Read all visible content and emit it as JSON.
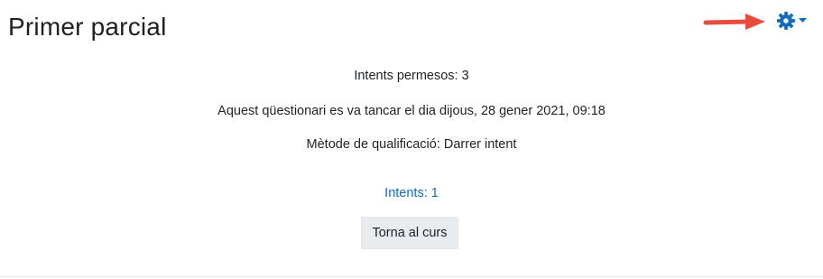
{
  "header": {
    "title": "Primer parcial"
  },
  "quiz_info": {
    "attempts_allowed": "Intents permesos: 3",
    "closed_notice": "Aquest qüestionari es va tancar el dia dijous, 28 gener 2021, 09:18",
    "grading_method": "Mètode de qualificació: Darrer intent"
  },
  "attempts_link": "Intents: 1",
  "back_button_label": "Torna al curs",
  "icons": {
    "settings": "gear-icon",
    "dropdown": "caret-down-icon",
    "annotation": "red-arrow-icon"
  },
  "colors": {
    "accent": "#0f6cbf",
    "arrow": "#e74c3c",
    "button_bg": "#e9ecef"
  }
}
